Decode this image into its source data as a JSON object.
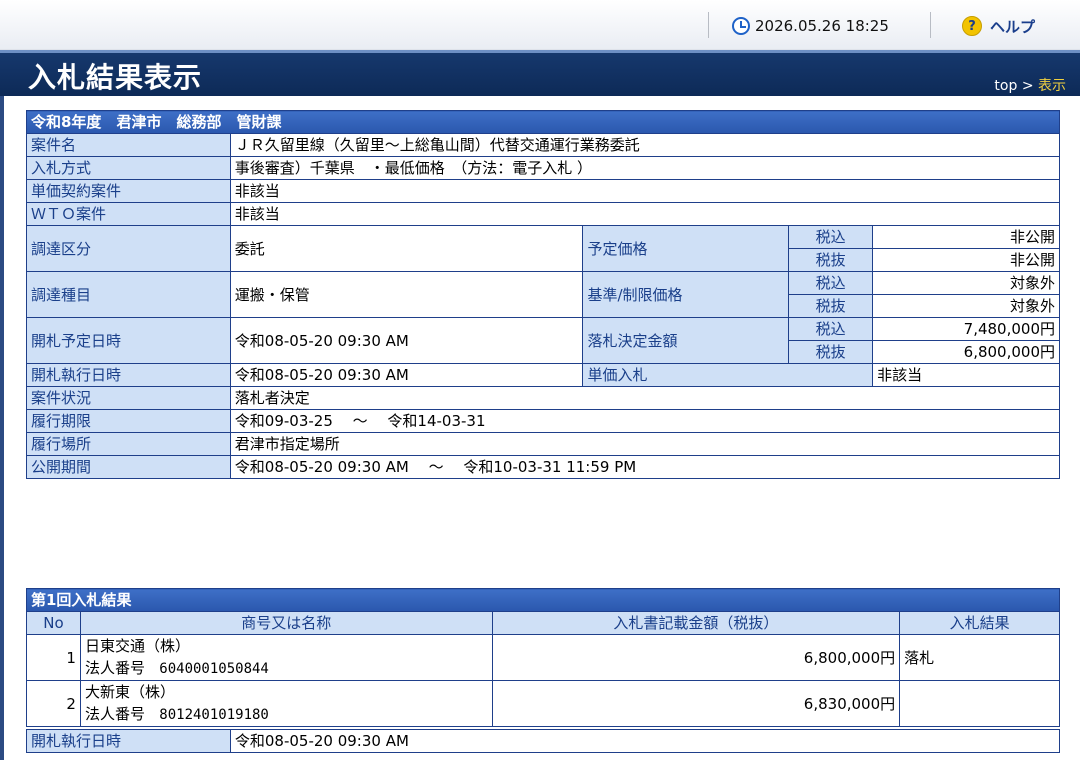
{
  "topbar": {
    "datetime": "2026.05.26 18:25",
    "help_label": "ヘルプ"
  },
  "header": {
    "title": "入札結果表示",
    "breadcrumb": {
      "top": "top",
      "sep": ">",
      "current": "表示"
    }
  },
  "info": {
    "heading": "令和8年度　君津市　総務部　管財課",
    "rows": {
      "case_name": {
        "label": "案件名",
        "value": "ＪＲ久留里線（久留里～上総亀山間）代替交通運行業務委託"
      },
      "bid_method": {
        "label": "入札方式",
        "value": "事後審査）千葉県　・最低価格　（方法：電子入札 ）"
      },
      "unit_price_contract": {
        "label": "単価契約案件",
        "value": "非該当"
      },
      "wto": {
        "label": "ＷＴＯ案件",
        "value": "非該当"
      },
      "procurement_class": {
        "label": "調達区分",
        "value": "委託"
      },
      "procurement_type": {
        "label": "調達種目",
        "value": "運搬・保管"
      },
      "scheduled_opening": {
        "label": "開札予定日時",
        "value": "令和08-05-20 09:30 AM"
      },
      "executed_opening": {
        "label": "開札執行日時",
        "value": "令和08-05-20 09:30 AM"
      },
      "status": {
        "label": "案件状況",
        "value": "落札者決定"
      },
      "deadline": {
        "label": "履行期限",
        "value": "令和09-03-25　 ～　 令和14-03-31"
      },
      "location": {
        "label": "履行場所",
        "value": "君津市指定場所"
      },
      "public_period": {
        "label": "公開期間",
        "value": "令和08-05-20 09:30 AM　 ～　 令和10-03-31 11:59 PM"
      }
    },
    "tax_incl": "税込",
    "tax_excl": "税抜",
    "planned_price": {
      "label": "予定価格",
      "incl": "非公開",
      "excl": "非公開"
    },
    "limit_price": {
      "label": "基準/制限価格",
      "incl": "対象外",
      "excl": "対象外"
    },
    "award_amount": {
      "label": "落札決定金額",
      "incl": "7,480,000円",
      "excl": "6,800,000円"
    },
    "unit_price_bid": {
      "label": "単価入札",
      "value": "非該当"
    }
  },
  "result": {
    "heading": "第1回入札結果",
    "columns": [
      "No",
      "商号又は名称",
      "入札書記載金額（税抜）",
      "入札結果"
    ],
    "bids": [
      {
        "no": "1",
        "name": "日東交通（株）",
        "corp_label": "法人番号",
        "corp_no": "6040001050844",
        "amount": "6,800,000円",
        "result": "落札"
      },
      {
        "no": "2",
        "name": "大新東（株）",
        "corp_label": "法人番号",
        "corp_no": "8012401019180",
        "amount": "6,830,000円",
        "result": ""
      }
    ],
    "executed_label": "開札執行日時",
    "executed_value": "令和08-05-20 09:30 AM"
  }
}
